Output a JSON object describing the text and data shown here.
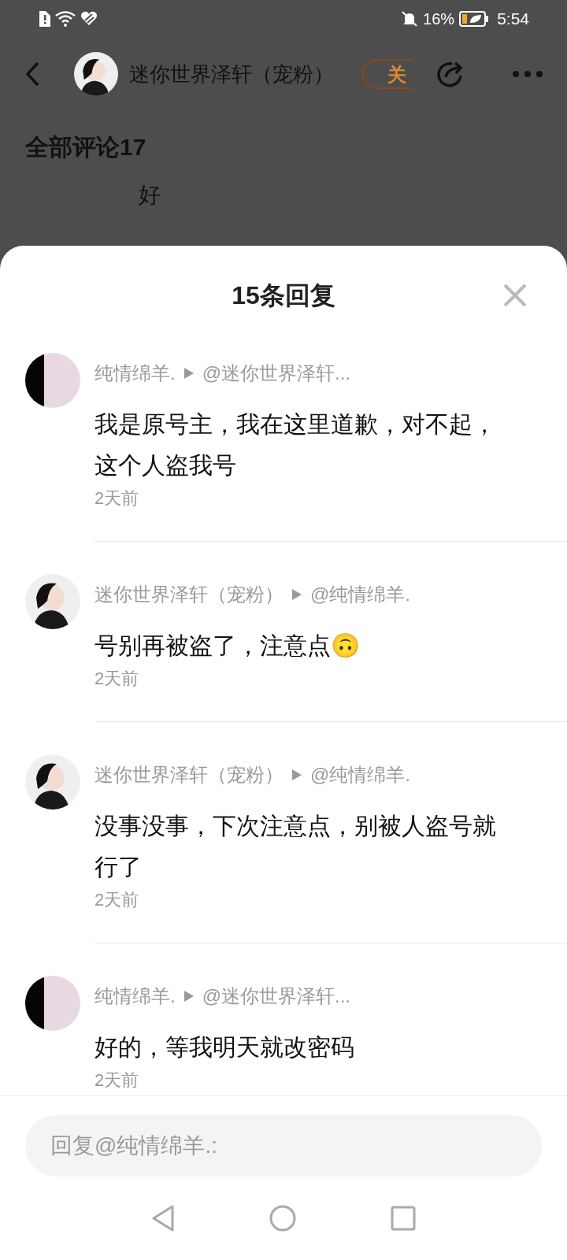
{
  "status_bar": {
    "battery": "16%",
    "time": "5:54"
  },
  "header": {
    "author": "迷你世界泽轩（宠粉）",
    "follow": "关"
  },
  "background_page": {
    "heading": "全部评论17",
    "comment": "好"
  },
  "replies_sheet": {
    "title": "15条回复",
    "replies": [
      {
        "kind": "split",
        "author": "纯情绵羊.",
        "reply_to": "@迷你世界泽轩...",
        "text": "我是原号主，我在这里道歉，对不起，这个人盗我号",
        "time": "2天前"
      },
      {
        "kind": "figure",
        "author": "迷你世界泽轩（宠粉）",
        "reply_to": "@纯情绵羊.",
        "text": "号别再被盗了，注意点🙃",
        "time": "2天前"
      },
      {
        "kind": "figure",
        "author": "迷你世界泽轩（宠粉）",
        "reply_to": "@纯情绵羊.",
        "text": "没事没事，下次注意点，别被人盗号就行了",
        "time": "2天前"
      },
      {
        "kind": "split",
        "author": "纯情绵羊.",
        "reply_to": "@迷你世界泽轩...",
        "text": "好的，等我明天就改密码",
        "time": "2天前"
      }
    ],
    "reply_field": {
      "placeholder": "回复@纯情绵羊.:"
    }
  }
}
